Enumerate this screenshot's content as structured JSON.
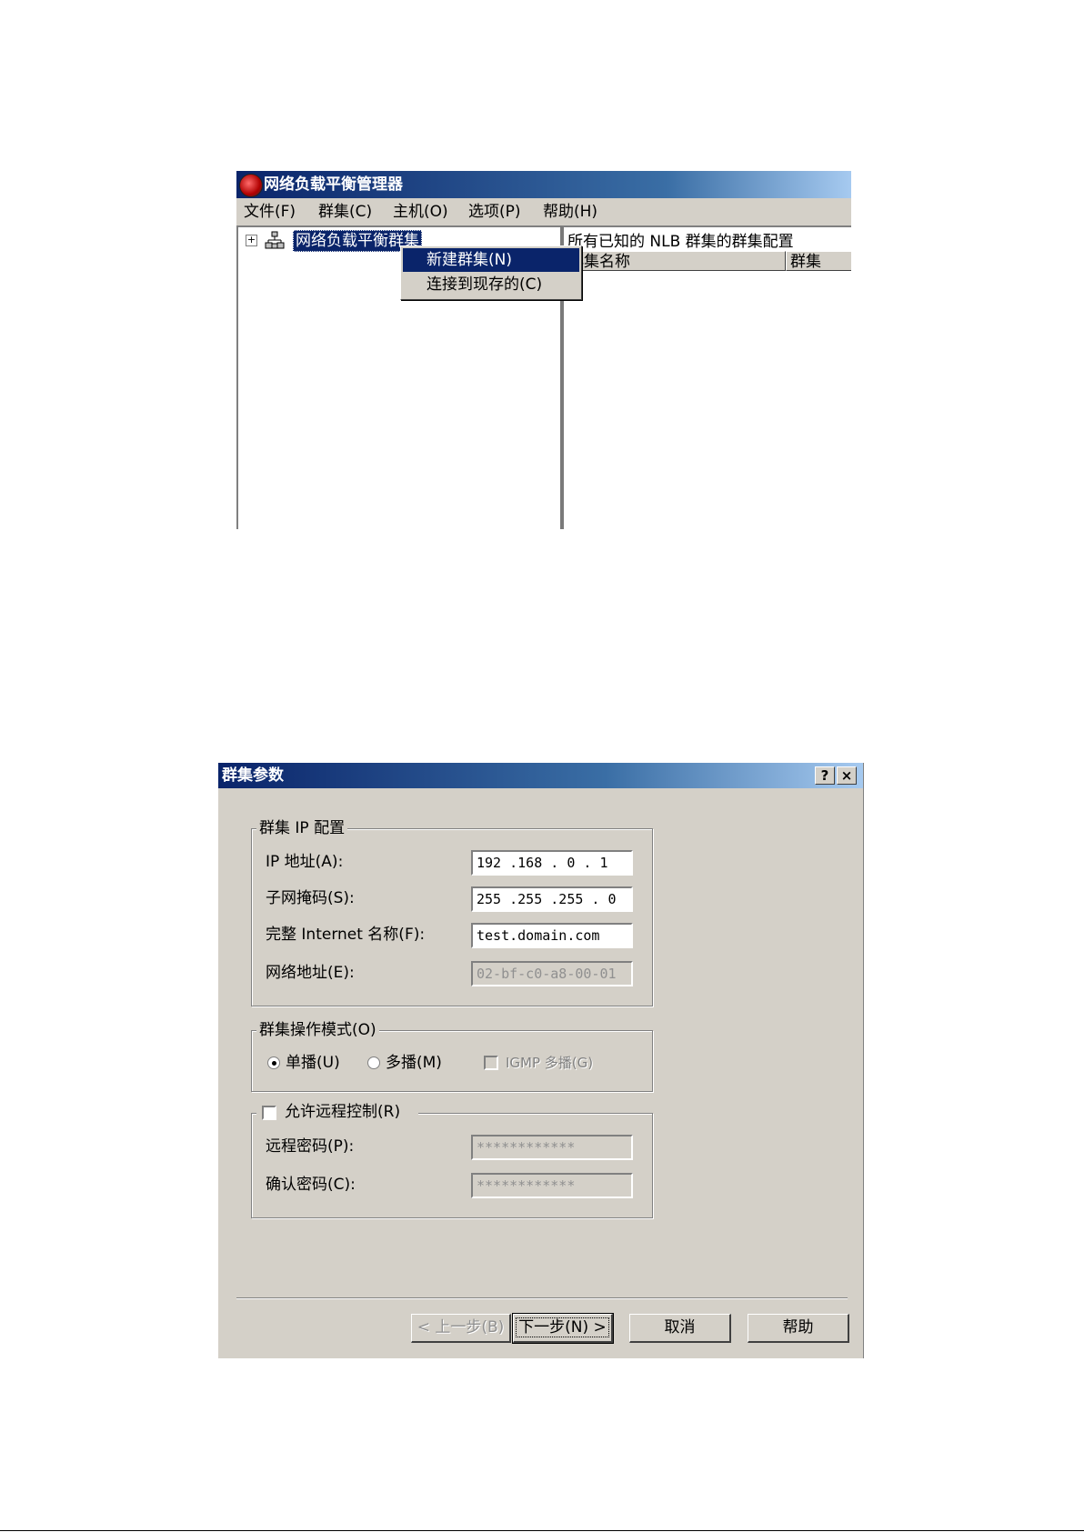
{
  "nlb_manager": {
    "title": "网络负载平衡管理器",
    "menu": [
      "文件(F)",
      "群集(C)",
      "主机(O)",
      "选项(P)",
      "帮助(H)"
    ],
    "tree_root": "网络负载平衡群集",
    "tree_expander": "+",
    "context_menu": {
      "items": [
        "新建群集(N)",
        "连接到现存的(C)"
      ]
    },
    "right_pane": {
      "header": "所有已知的 NLB 群集的群集配置",
      "columns": [
        "群集名称",
        "群集"
      ]
    }
  },
  "cluster_params": {
    "title": "群集参数",
    "help_btn": "?",
    "close_btn": "×",
    "ip_group": {
      "legend": "群集 IP 配置",
      "ip_label": "IP 地址(A):",
      "ip_value": "192 .168 . 0  . 1",
      "mask_label": "子网掩码(S):",
      "mask_value": "255 .255 .255 . 0",
      "fqdn_label": "完整 Internet 名称(F):",
      "fqdn_value": "test.domain.com",
      "netaddr_label": "网络地址(E):",
      "netaddr_value": "02-bf-c0-a8-00-01"
    },
    "mode_group": {
      "legend": "群集操作模式(O)",
      "unicast": "单播(U)",
      "multicast": "多播(M)",
      "igmp": "IGMP 多播(G)"
    },
    "remote_group": {
      "legend": "允许远程控制(R)",
      "password_label": "远程密码(P):",
      "password_value": "************",
      "confirm_label": "确认密码(C):",
      "confirm_value": "************"
    },
    "buttons": {
      "back": "< 上一步(B)",
      "next": "下一步(N) >",
      "cancel": "取消",
      "help": "帮助"
    }
  }
}
